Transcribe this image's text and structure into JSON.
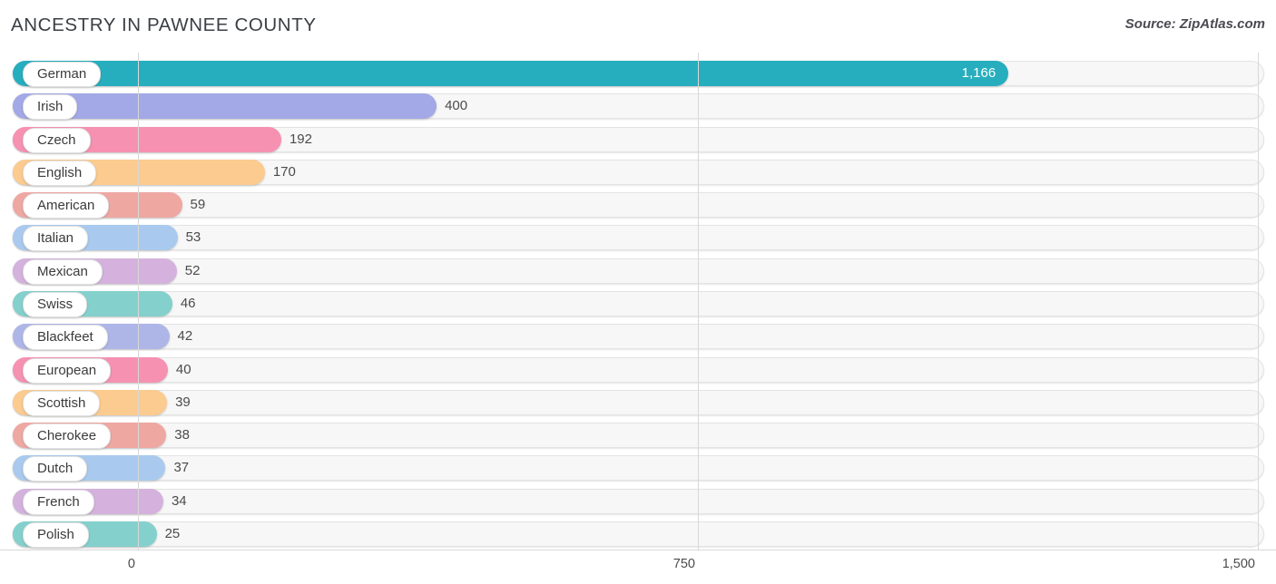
{
  "header": {
    "title": "ANCESTRY IN PAWNEE COUNTY",
    "source": "Source: ZipAtlas.com"
  },
  "axis": {
    "ticks": [
      "0",
      "750",
      "1,500"
    ]
  },
  "chart_data": {
    "type": "bar",
    "orientation": "horizontal",
    "title": "ANCESTRY IN PAWNEE COUNTY",
    "xlabel": "",
    "ylabel": "",
    "xlim": [
      0,
      1500
    ],
    "xticks": [
      0,
      750,
      1500
    ],
    "xticklabels": [
      "0",
      "750",
      "1,500"
    ],
    "grid": true,
    "legend": "none",
    "categories": [
      "German",
      "Irish",
      "Czech",
      "English",
      "American",
      "Italian",
      "Mexican",
      "Swiss",
      "Blackfeet",
      "European",
      "Scottish",
      "Cherokee",
      "Dutch",
      "French",
      "Polish"
    ],
    "values": [
      1166,
      400,
      192,
      170,
      59,
      53,
      52,
      46,
      42,
      40,
      39,
      38,
      37,
      34,
      25
    ],
    "value_labels": [
      "1,166",
      "400",
      "192",
      "170",
      "59",
      "53",
      "52",
      "46",
      "42",
      "40",
      "39",
      "38",
      "37",
      "34",
      "25"
    ],
    "bar_colors": [
      "#27AEBE",
      "#A3A8E6",
      "#F691B2",
      "#FBCB8F",
      "#EFA7A2",
      "#A9CAEE",
      "#D4B2DD",
      "#84D0CC",
      "#AEB6E8",
      "#F691B2",
      "#FBCB8F",
      "#EFA7A2",
      "#A9CAEE",
      "#D4B2DD",
      "#84D0CC"
    ],
    "rows": [
      {
        "label": "German",
        "value": 1166,
        "value_label": "1,166",
        "color": "#27AEBE",
        "label_inside": true
      },
      {
        "label": "Irish",
        "value": 400,
        "value_label": "400",
        "color": "#A3A8E6",
        "label_inside": false
      },
      {
        "label": "Czech",
        "value": 192,
        "value_label": "192",
        "color": "#F691B2",
        "label_inside": false
      },
      {
        "label": "English",
        "value": 170,
        "value_label": "170",
        "color": "#FBCB8F",
        "label_inside": false
      },
      {
        "label": "American",
        "value": 59,
        "value_label": "59",
        "color": "#EFA7A2",
        "label_inside": false
      },
      {
        "label": "Italian",
        "value": 53,
        "value_label": "53",
        "color": "#A9CAEE",
        "label_inside": false
      },
      {
        "label": "Mexican",
        "value": 52,
        "value_label": "52",
        "color": "#D4B2DD",
        "label_inside": false
      },
      {
        "label": "Swiss",
        "value": 46,
        "value_label": "46",
        "color": "#84D0CC",
        "label_inside": false
      },
      {
        "label": "Blackfeet",
        "value": 42,
        "value_label": "42",
        "color": "#AEB6E8",
        "label_inside": false
      },
      {
        "label": "European",
        "value": 40,
        "value_label": "40",
        "color": "#F691B2",
        "label_inside": false
      },
      {
        "label": "Scottish",
        "value": 39,
        "value_label": "39",
        "color": "#FBCB8F",
        "label_inside": false
      },
      {
        "label": "Cherokee",
        "value": 38,
        "value_label": "38",
        "color": "#EFA7A2",
        "label_inside": false
      },
      {
        "label": "Dutch",
        "value": 37,
        "value_label": "37",
        "color": "#A9CAEE",
        "label_inside": false
      },
      {
        "label": "French",
        "value": 34,
        "value_label": "34",
        "color": "#D4B2DD",
        "label_inside": false
      },
      {
        "label": "Polish",
        "value": 25,
        "value_label": "25",
        "color": "#84D0CC",
        "label_inside": false
      }
    ]
  }
}
